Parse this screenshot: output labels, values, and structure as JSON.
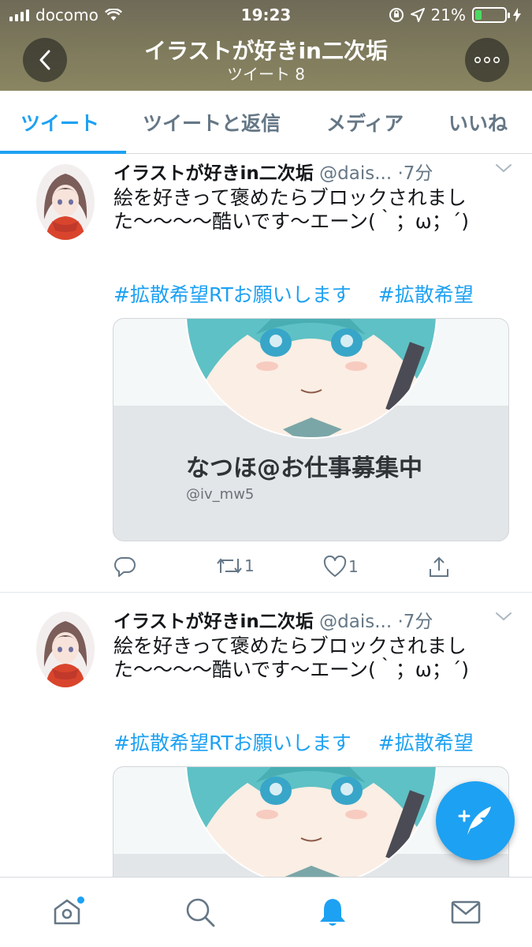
{
  "status_bar": {
    "carrier": "docomo",
    "time": "19:23",
    "battery": "21%",
    "battery_level": 0.21
  },
  "header": {
    "title": "イラストが好きin二次垢",
    "subtitle": "ツイート 8",
    "back_icon": "chevron-left-icon",
    "more_icon": "more-dots-icon"
  },
  "tabs": [
    {
      "label": "ツイート",
      "active": true
    },
    {
      "label": "ツイートと返信",
      "active": false
    },
    {
      "label": "メディア",
      "active": false
    },
    {
      "label": "いいね",
      "active": false
    }
  ],
  "tweets": [
    {
      "name": "イラストが好きin二次垢",
      "handle": "@dais...",
      "time": "·7分",
      "text": "絵を好きって褒めたらブロックされました〜〜〜〜酷いです〜エーン(｀；ω；´)",
      "hashtags": [
        "#拡散希望RTお願いします",
        "#拡散希望"
      ],
      "card": {
        "name": "なつほ@お仕事募集中",
        "handle": "@iv_mw5"
      },
      "replies": "",
      "retweets": "1",
      "likes": "1"
    },
    {
      "name": "イラストが好きin二次垢",
      "handle": "@dais...",
      "time": "·7分",
      "text": "絵を好きって褒めたらブロックされました〜〜〜〜酷いです〜エーン(｀；ω；´)",
      "hashtags": [
        "#拡散希望RTお願いします",
        "#拡散希望"
      ]
    }
  ],
  "bottom_nav": [
    {
      "icon": "home-icon",
      "active": false,
      "badge": true
    },
    {
      "icon": "search-icon",
      "active": false
    },
    {
      "icon": "bell-icon",
      "active": true
    },
    {
      "icon": "mail-icon",
      "active": false
    }
  ],
  "colors": {
    "accent": "#1da1f2",
    "text": "#14171a",
    "secondary": "#657786"
  }
}
